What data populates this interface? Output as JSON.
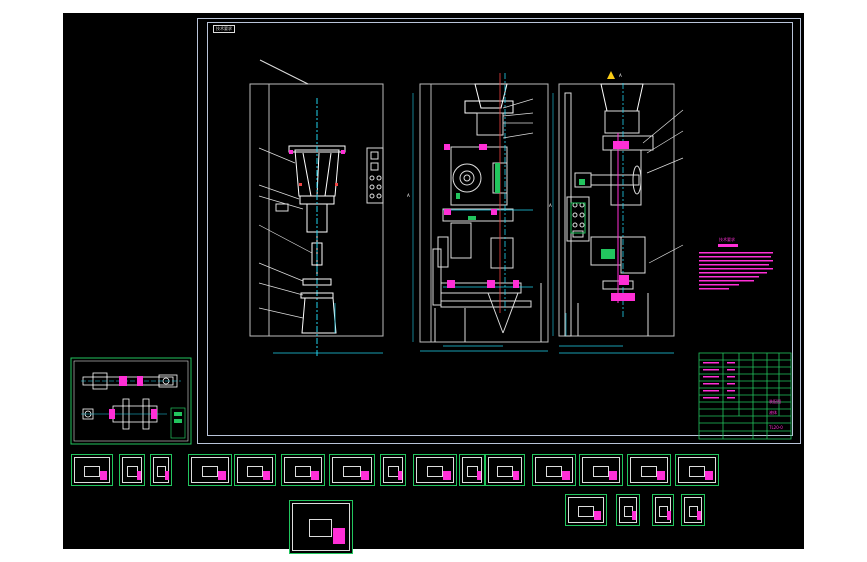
{
  "drawing": {
    "sheet_label": "技术要求",
    "title_block": {
      "rows": 12,
      "title_top": "装配图",
      "title_mid": "液体",
      "drawing_no": "TL20-0"
    },
    "notes_title": "技术要求",
    "notes_lines": 10,
    "side_label_left": "A",
    "side_label_right": "A",
    "arrow_label": "A",
    "colors": {
      "background": "#000000",
      "outline": "#ffffff",
      "cyan": "#22d3ee",
      "magenta": "#ff2fd6",
      "green": "#22c55e",
      "red": "#ef4444",
      "yellow": "#facc15"
    }
  },
  "thumbnails": {
    "count_row1": 17,
    "count_row2": 5
  }
}
